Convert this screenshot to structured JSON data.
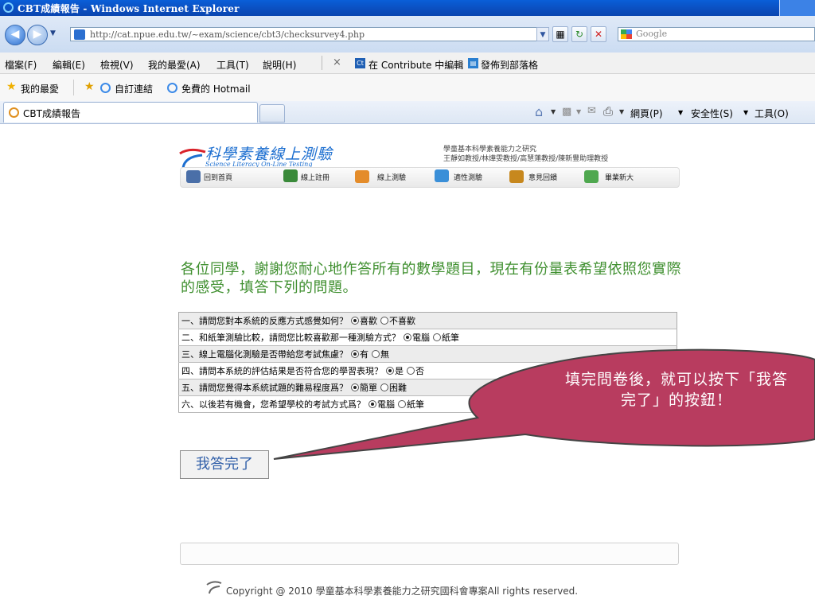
{
  "window": {
    "title": "CBT成績報告 - Windows Internet Explorer"
  },
  "toolbar": {
    "address": "http://cat.npue.edu.tw/~exam/science/cbt3/checksurvey4.php",
    "search_placeholder": "Google"
  },
  "menu": [
    "檔案(F)",
    "編輯(E)",
    "檢視(V)",
    "我的最愛(A)",
    "工具(T)",
    "說明(H)"
  ],
  "menu_extra": {
    "contribute": "在 Contribute 中編輯",
    "publish": "發佈到部落格",
    "close": "×"
  },
  "favorites": {
    "label": "我的最愛",
    "links": [
      "自訂連結",
      "免費的 Hotmail"
    ]
  },
  "tab": {
    "title": "CBT成績報告"
  },
  "commands": {
    "page": "網頁(P)",
    "safety": "安全性(S)",
    "tools": "工具(O)"
  },
  "site": {
    "title": "科學素養線上測驗",
    "subtitle": "Science Literacy On-Line Testing",
    "credit_line1": "學童基本科學素養能力之研究",
    "credit_line2": "王靜如教授/林燁雯教授/高慧蓮教授/陳新豐助理教授",
    "nav": [
      "回到首頁",
      "線上註冊",
      "線上測驗",
      "適性測驗",
      "意見回饋",
      "畢業新大"
    ]
  },
  "intro": "各位同學，謝謝您耐心地作答所有的數學題目，現在有份量表希望依照您實際的感受，填答下列的問題。",
  "survey": [
    {
      "q": "一、請問您對本系統的反應方式感覺如何？",
      "options": [
        "喜歡",
        "不喜歡"
      ],
      "selected": 0
    },
    {
      "q": "二、和紙筆測驗比較，請問您比較喜歡那一種測驗方式？",
      "options": [
        "電腦",
        "紙筆"
      ],
      "selected": 0
    },
    {
      "q": "三、線上電腦化測驗是否帶給您考試焦慮？",
      "options": [
        "有",
        "無"
      ],
      "selected": 0
    },
    {
      "q": "四、請問本系統的評估結果是否符合您的學習表現？",
      "options": [
        "是",
        "否"
      ],
      "selected": 0
    },
    {
      "q": "五、請問您覺得本系統試題的難易程度爲？",
      "options": [
        "簡單",
        "困難"
      ],
      "selected": 0
    },
    {
      "q": "六、以後若有機會，您希望學校的考試方式爲？",
      "options": [
        "電腦",
        "紙筆"
      ],
      "selected": 0
    }
  ],
  "submit_label": "我答完了",
  "copyright": "Copyright @ 2010 學童基本科學素養能力之研究國科會專案All rights reserved.",
  "callout": {
    "line1": "填完問卷後，就可以按下「我答",
    "line2": "完了」的按鈕！",
    "color": "#b83c5f"
  }
}
